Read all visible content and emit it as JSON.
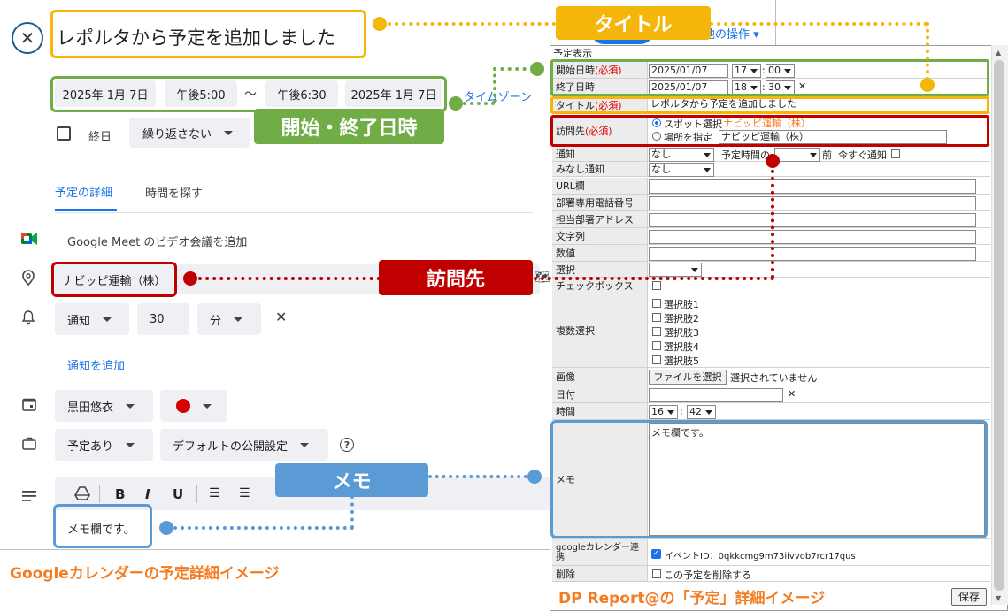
{
  "google": {
    "title": "レポルタから予定を追加しました",
    "start_date": "2025年 1月 7日",
    "start_time": "午後5:00",
    "tilde": "～",
    "end_time": "午後6:30",
    "end_date": "2025年 1月 7日",
    "timezone_link": "タイムゾーン",
    "allday_label": "終日",
    "repeat": "繰り返さない",
    "tab_details": "予定の詳細",
    "tab_find_time": "時間を探す",
    "meet_label": "Google Meet のビデオ会議を追加",
    "location": "ナビッピ運輸（株）",
    "notify_type": "通知",
    "notify_value": "30",
    "notify_unit": "分",
    "add_notify": "通知を追加",
    "calendar_owner": "黒田悠衣",
    "busy_status": "予定あり",
    "visibility": "デフォルトの公開設定",
    "memo": "メモ欄です。",
    "other_ops": "他の操作",
    "caption": "Googleカレンダーの予定詳細イメージ"
  },
  "callouts": {
    "title": "タイトル",
    "datetime": "開始・終了日時",
    "visit": "訪問先",
    "memo": "メモ"
  },
  "dp": {
    "header": "予定表示",
    "start_label": "開始日時",
    "end_label": "終了日時",
    "required": "(必須)",
    "start_date": "2025/01/07",
    "start_hour": "17",
    "start_min": "00",
    "end_date": "2025/01/07",
    "end_hour": "18",
    "end_min": "30",
    "title_label": "タイトル",
    "title_value": "レポルタから予定を追加しました",
    "visit_label": "訪問先",
    "spot_select": "スポット選択",
    "spot_value": "ナビッピ運輸（株）",
    "place_specify": "場所を指定",
    "place_value": "ナビッピ運輸（株）",
    "notify_label": "通知",
    "notify_value": "なし",
    "notify_before": "予定時間の",
    "notify_mae": "前",
    "notify_now": "今すぐ通知",
    "deemed_label": "みなし通知",
    "deemed_value": "なし",
    "url_label": "URL欄",
    "phone_label": "部署専用電話番号",
    "addr_label": "担当部署アドレス",
    "string_label": "文字列",
    "number_label": "数値",
    "select_label": "選択",
    "checkbox_label": "チェックボックス",
    "multi_label": "複数選択",
    "options": [
      "選択肢1",
      "選択肢2",
      "選択肢3",
      "選択肢4",
      "選択肢5"
    ],
    "image_label": "画像",
    "file_button": "ファイルを選択",
    "file_status": "選択されていません",
    "date_label": "日付",
    "time_label": "時間",
    "time_hour": "16",
    "time_min": "42",
    "memo_label": "メモ",
    "memo_value": "メモ欄です。",
    "gcal_label": "googleカレンダー連携",
    "event_id": "イベントID：0qkkcmg9m73iivvob7rcr17qus",
    "delete_label": "削除",
    "delete_check": "この予定を削除する",
    "save_button": "保存",
    "caption": "DP Report@の「予定」詳細イメージ"
  },
  "colors": {
    "yellow": "#f5b60b",
    "green": "#70ad47",
    "red": "#c00000",
    "blue": "#5b9bd5",
    "orange": "#f47c20"
  }
}
